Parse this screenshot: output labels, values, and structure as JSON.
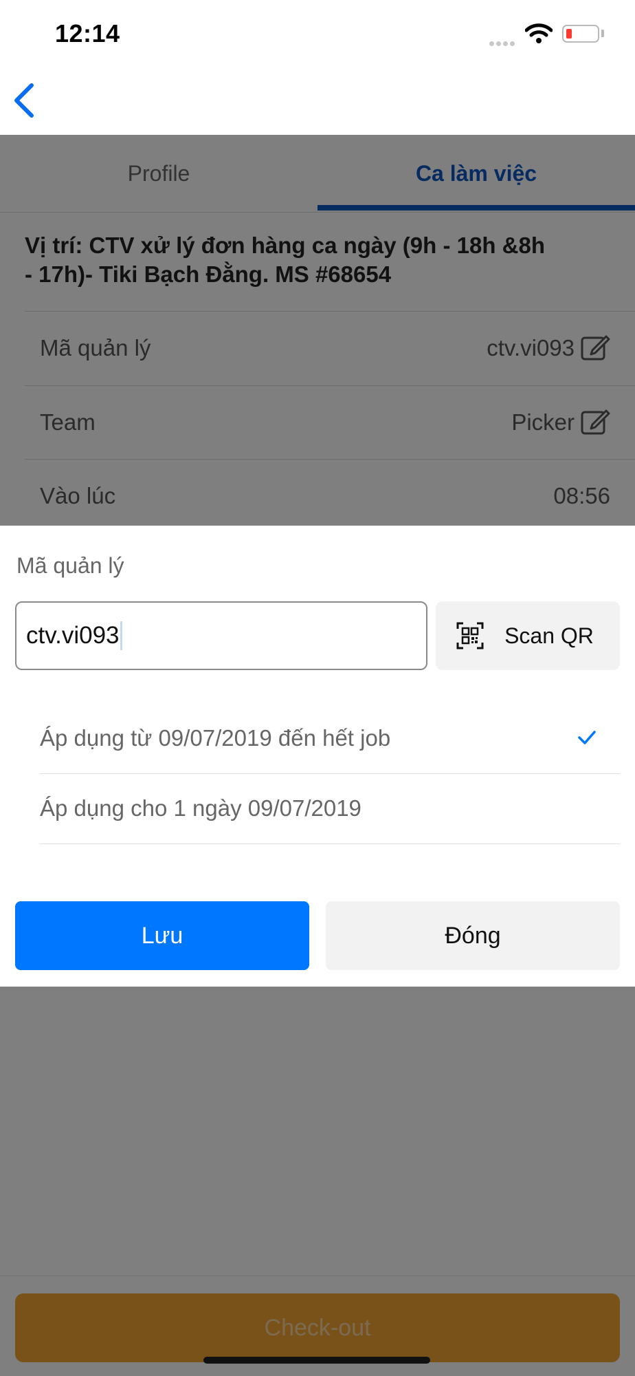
{
  "status_bar": {
    "time": "12:14"
  },
  "tabs": [
    {
      "label": "Profile",
      "active": false
    },
    {
      "label": "Ca làm việc",
      "active": true
    }
  ],
  "job": {
    "title_line1": "Vị trí: CTV xử lý đơn hàng ca ngày (9h - 18h &8h",
    "title_line2": "- 17h)- Tiki Bạch Đằng. MS #68654"
  },
  "info_rows": [
    {
      "label": "Mã quản lý",
      "value": "ctv.vi093"
    },
    {
      "label": "Team",
      "value": "Picker"
    },
    {
      "label": "Vào lúc",
      "value": "08:56"
    }
  ],
  "modal": {
    "field_label": "Mã quản lý",
    "input_value": "ctv.vi093",
    "scan_label": "Scan QR",
    "options": [
      {
        "label": "Áp dụng từ 09/07/2019 đến hết job",
        "selected": true
      },
      {
        "label": "Áp dụng cho 1 ngày 09/07/2019",
        "selected": false
      }
    ],
    "save_label": "Lưu",
    "close_label": "Đóng"
  },
  "footer": {
    "checkout_label": "Check-out"
  },
  "colors": {
    "accent_blue": "#0077ff",
    "tab_active": "#0a56c2",
    "checkout": "#f3a534",
    "check_mark": "#0077ff"
  },
  "icons": [
    "back-chevron-icon",
    "wifi-icon",
    "battery-icon",
    "edit-icon",
    "qr-code-icon",
    "checkmark-icon"
  ]
}
